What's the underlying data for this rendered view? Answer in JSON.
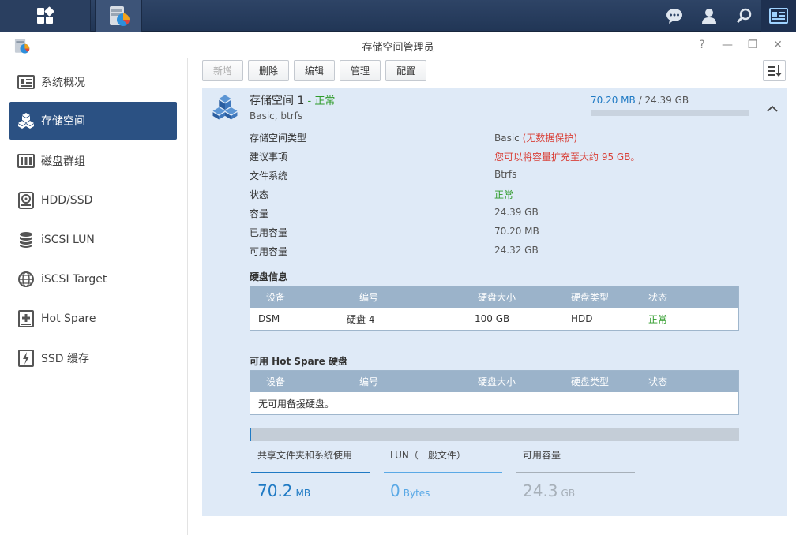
{
  "window": {
    "title": "存储空间管理员"
  },
  "toolbar": {
    "create": "新增",
    "delete": "删除",
    "edit": "编辑",
    "manage": "管理",
    "config": "配置"
  },
  "sidebar": {
    "items": [
      {
        "label": "系统概况",
        "icon": "overview-icon"
      },
      {
        "label": "存储空间",
        "icon": "storage-cubes-icon"
      },
      {
        "label": "磁盘群组",
        "icon": "disk-group-icon"
      },
      {
        "label": "HDD/SSD",
        "icon": "hdd-icon"
      },
      {
        "label": "iSCSI LUN",
        "icon": "lun-icon"
      },
      {
        "label": "iSCSI Target",
        "icon": "target-icon"
      },
      {
        "label": "Hot Spare",
        "icon": "hot-spare-icon"
      },
      {
        "label": "SSD 缓存",
        "icon": "ssd-cache-icon"
      }
    ]
  },
  "volume": {
    "name": "存储空间 1",
    "separator": " - ",
    "status": "正常",
    "subtitle": "Basic, btrfs",
    "used_text": "70.20 MB",
    "total_text": " / 24.39 GB",
    "used_fraction": 0.003,
    "properties": [
      {
        "label": "存储空间类型",
        "value": "Basic",
        "note": "(无数据保护)"
      },
      {
        "label": "建议事项",
        "value": "您可以将容量扩充至大约 95 GB。"
      },
      {
        "label": "文件系统",
        "value": "Btrfs"
      },
      {
        "label": "状态",
        "value": "正常"
      },
      {
        "label": "容量",
        "value": "24.39 GB"
      },
      {
        "label": "已用容量",
        "value": "70.20 MB"
      },
      {
        "label": "可用容量",
        "value": "24.32 GB"
      }
    ]
  },
  "disk_info": {
    "title": "硬盘信息",
    "columns": [
      "设备",
      "编号",
      "硬盘大小",
      "硬盘类型",
      "状态"
    ],
    "rows": [
      {
        "device": "DSM",
        "number": "硬盘 4",
        "size": "100 GB",
        "type": "HDD",
        "status": "正常"
      }
    ]
  },
  "hot_spare": {
    "title": "可用 Hot Spare 硬盘",
    "columns": [
      "设备",
      "编号",
      "硬盘大小",
      "硬盘类型",
      "状态"
    ],
    "empty_text": "无可用备援硬盘。"
  },
  "summary": [
    {
      "label": "共享文件夹和系统使用",
      "value": "70.2",
      "unit": "MB",
      "color": "#1f7ac4"
    },
    {
      "label": "LUN（一般文件）",
      "value": "0",
      "unit": "Bytes",
      "color": "#5aa9e6"
    },
    {
      "label": "可用容量",
      "value": "24.3",
      "unit": "GB",
      "color": "#a7b0b9"
    }
  ],
  "colors": {
    "accent": "#2b5183",
    "ok": "#2e9b29",
    "warn": "#d9423a",
    "panel": "#dfeaf7"
  }
}
